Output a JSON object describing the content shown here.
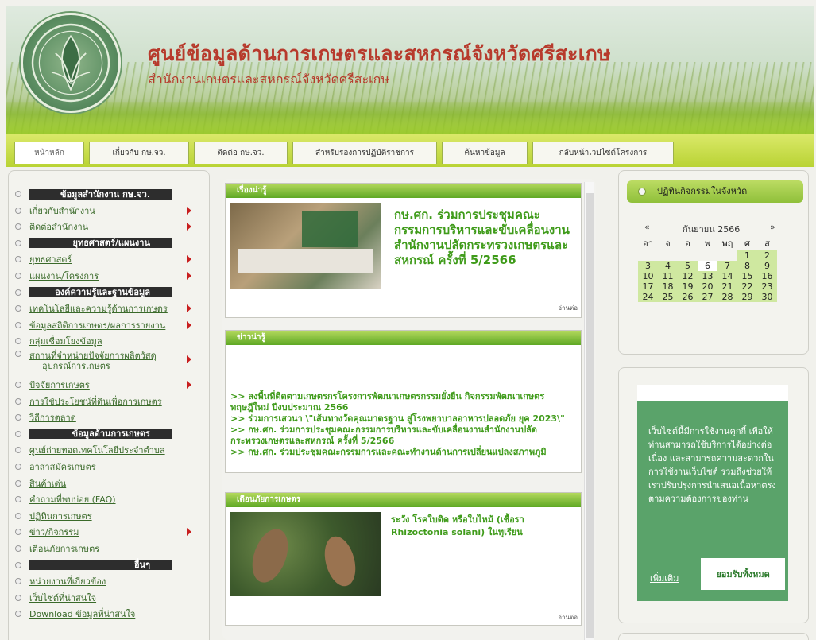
{
  "header": {
    "title": "ศูนย์ข้อมูลด้านการเกษตรและสหกรณ์จังหวัดศรีสะเกษ",
    "subtitle": "สำนักงานเกษตรและสหกรณ์จังหวัดศรีสะเกษ"
  },
  "nav": {
    "tabs": [
      "หน้าหลัก",
      "เกี่ยวกับ กษ.จว.",
      "ติดต่อ กษ.จว.",
      "สำหรับรองการปฏิบัติราชการ",
      "ค้นหาข้อมูล",
      "กลับหน้าเวปไซต์โครงการ"
    ]
  },
  "sidebar": {
    "rows": [
      {
        "type": "head",
        "label": "ข้อมูลสำนักงาน กษ.จว."
      },
      {
        "type": "link",
        "label": "เกี่ยวกับสำนักงาน",
        "arrow": true
      },
      {
        "type": "link",
        "label": "ติดต่อสำนักงาน",
        "arrow": true
      },
      {
        "type": "head",
        "label": "ยุทธศาสตร์/แผนงาน"
      },
      {
        "type": "link",
        "label": "ยุทธศาสตร์",
        "arrow": true
      },
      {
        "type": "link",
        "label": "แผนงาน/โครงการ",
        "arrow": true
      },
      {
        "type": "head",
        "label": "องค์ความรู้และฐานข้อมูล"
      },
      {
        "type": "link",
        "label": "เทคโนโลยีและความรู้ด้านการเกษตร",
        "arrow": true
      },
      {
        "type": "link",
        "label": "ข้อมูลสถิติการเกษตร/ผลการรายงาน",
        "arrow": true
      },
      {
        "type": "link",
        "label": "กลุ่มเชื่อมโยงข้อมูล",
        "arrow": false
      },
      {
        "type": "link2",
        "label": "สถานที่จำหน่ายปัจจัยการผลิตวัสดุ",
        "label2": "อุปกรณ์การเกษตร",
        "arrow": true
      },
      {
        "type": "link",
        "label": "ปัจจัยการเกษตร",
        "arrow": true
      },
      {
        "type": "link",
        "label": "การใช้ประโยชน์ที่ดินเพื่อการเกษตร",
        "arrow": false
      },
      {
        "type": "link",
        "label": "วิถีการตลาด",
        "arrow": false
      },
      {
        "type": "head",
        "label": "ข้อมูลด้านการเกษตร"
      },
      {
        "type": "link",
        "label": "ศูนย์ถ่ายทอดเทคโนโลยีประจำตำบล",
        "arrow": false
      },
      {
        "type": "link",
        "label": "อาสาสมัครเกษตร",
        "arrow": false
      },
      {
        "type": "link",
        "label": "สินค้าเด่น",
        "arrow": false
      },
      {
        "type": "link",
        "label": "คำถามที่พบบ่อย (FAQ)",
        "arrow": false
      },
      {
        "type": "link",
        "label": "ปฏิทินการเกษตร",
        "arrow": false
      },
      {
        "type": "link",
        "label": "ข่าว/กิจกรรม",
        "arrow": true
      },
      {
        "type": "link",
        "label": "เตือนภัยการเกษตร",
        "arrow": false
      },
      {
        "type": "head",
        "label": "อื่นๆ"
      },
      {
        "type": "link",
        "label": "หน่วยงานที่เกี่ยวข้อง",
        "arrow": false
      },
      {
        "type": "link",
        "label": "เว็บไซต์ที่น่าสนใจ",
        "arrow": false
      },
      {
        "type": "link",
        "label": "Download ข้อมูลที่น่าสนใจ",
        "arrow": false
      }
    ]
  },
  "featured": {
    "head": "เรื่องน่ารู้",
    "title": "กษ.ศก. ร่วมการประชุมคณะกรรมการบริหารและขับเคลื่อนงานสำนักงานปลัดกระทรวงเกษตรและสหกรณ์ ครั้งที่ 5/2566",
    "readmore": "อ่านต่อ"
  },
  "hotnews": {
    "head": "ข่าวน่ารู้",
    "items": [
      ">> ลงพื้นที่ติดตามเกษตรกรโครงการพัฒนาเกษตรกรรมยั่งยืน กิจกรรมพัฒนาเกษตร",
      "ทฤษฎีใหม่ ปีงบประมาณ 2566",
      ">> ร่วมการเสวนา \\\"เส้นทางวัดคุณมาตรฐาน สู่โรงพยาบาลอาหารปลอดภัย ยุค 2023\\\"",
      ">> กษ.ศก. ร่วมการประชุมคณะกรรมการบริหารและขับเคลื่อนงานสำนักงานปลัด",
      "กระทรวงเกษตรและสหกรณ์ ครั้งที่ 5/2566",
      ">> กษ.ศก. ร่วมประชุมคณะกรรมการและคณะทำงานด้านการเปลี่ยนแปลงสภาพภูมิ"
    ]
  },
  "alert": {
    "head": "เตือนภัยการเกษตร",
    "title": "ระวัง โรคใบติด หรือใบไหม้ (เชื้อรา Rhizoctonia solani) ในทุเรียน",
    "readmore": "อ่านต่อ"
  },
  "calendar": {
    "head": "ปฏิทินกิจกรรมในจังหวัด",
    "prev": "«",
    "next": "»",
    "month": "กันยายน 2566",
    "weekdays": [
      "อา",
      "จ",
      "อ",
      "พ",
      "พฤ",
      "ศ",
      "ส"
    ],
    "weeks": [
      [
        "",
        "",
        "",
        "",
        "",
        "1",
        "2"
      ],
      [
        "3",
        "4",
        "5",
        "6",
        "7",
        "8",
        "9"
      ],
      [
        "10",
        "11",
        "12",
        "13",
        "14",
        "15",
        "16"
      ],
      [
        "17",
        "18",
        "19",
        "20",
        "21",
        "22",
        "23"
      ],
      [
        "24",
        "25",
        "26",
        "27",
        "28",
        "29",
        "30"
      ]
    ],
    "today": "6"
  },
  "cookie": {
    "text": "เว็บไซต์นี้มีการใช้งานคุกกี้ เพื่อให้ท่านสามารถใช้บริการได้อย่างต่อเนื่อง และสามารถความสะดวกในการใช้งานเว็บไซต์ รวมถึงช่วยให้เราปรับปรุงการนำเสนอเนื้อหาตรงตามความต้องการของท่าน",
    "more": "เพิ่มเติม",
    "accept": "ยอมรับทั้งหมด"
  },
  "colors": {
    "accent_green": "#5fa824",
    "title_red": "#b73a2c",
    "cookie_green": "#5aa36a"
  }
}
